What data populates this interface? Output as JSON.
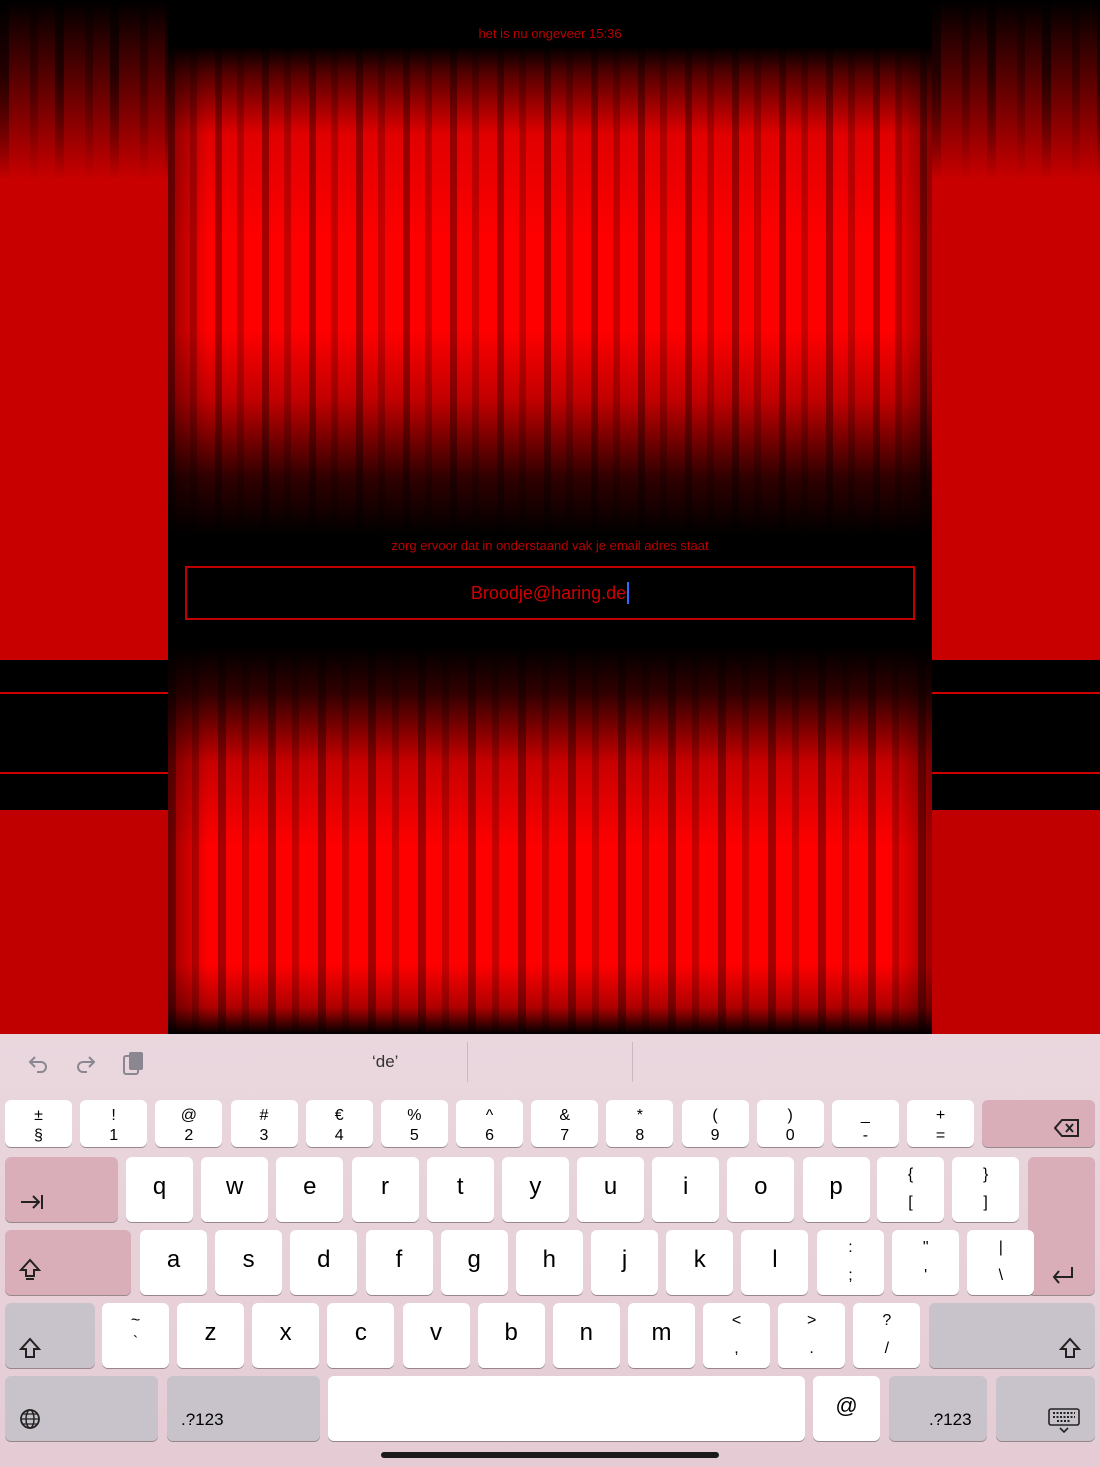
{
  "status": {
    "time_text": "het is nu ongeveer 15:36"
  },
  "form": {
    "instruction": "zorg ervoor dat in onderstaand vak je email adres staat",
    "email_value": "Broodje@haring.de"
  },
  "colors": {
    "accent": "#d00000",
    "background": "#000000",
    "caret": "#2f6bff"
  },
  "keyboard": {
    "toolbar": {
      "suggestion": "‘de’",
      "icons": [
        "undo-icon",
        "redo-icon",
        "clipboard-icon"
      ]
    },
    "row1": [
      {
        "t": "±",
        "b": "§"
      },
      {
        "t": "!",
        "b": "1"
      },
      {
        "t": "@",
        "b": "2"
      },
      {
        "t": "#",
        "b": "3"
      },
      {
        "t": "€",
        "b": "4"
      },
      {
        "t": "%",
        "b": "5"
      },
      {
        "t": "^",
        "b": "6"
      },
      {
        "t": "&",
        "b": "7"
      },
      {
        "t": "*",
        "b": "8"
      },
      {
        "t": "(",
        "b": "9"
      },
      {
        "t": ")",
        "b": "0"
      },
      {
        "t": "_",
        "b": "-"
      },
      {
        "t": "+",
        "b": "="
      }
    ],
    "row2": [
      "q",
      "w",
      "e",
      "r",
      "t",
      "y",
      "u",
      "i",
      "o",
      "p"
    ],
    "row2_extra": [
      {
        "t": "{",
        "b": "["
      },
      {
        "t": "}",
        "b": "]"
      }
    ],
    "row3": [
      "a",
      "s",
      "d",
      "f",
      "g",
      "h",
      "j",
      "k",
      "l"
    ],
    "row3_extra": [
      {
        "t": ":",
        "b": ";"
      },
      {
        "t": "\"",
        "b": "'"
      },
      {
        "t": "|",
        "b": "\\"
      }
    ],
    "row4_first": {
      "t": "~",
      "b": "`"
    },
    "row4": [
      "z",
      "x",
      "c",
      "v",
      "b",
      "n",
      "m"
    ],
    "row4_extra": [
      {
        "t": "<",
        "b": ","
      },
      {
        "t": ">",
        "b": "."
      },
      {
        "t": "?",
        "b": "/"
      }
    ],
    "row5": {
      "numbers_label": ".?123",
      "at_label": "@"
    }
  }
}
